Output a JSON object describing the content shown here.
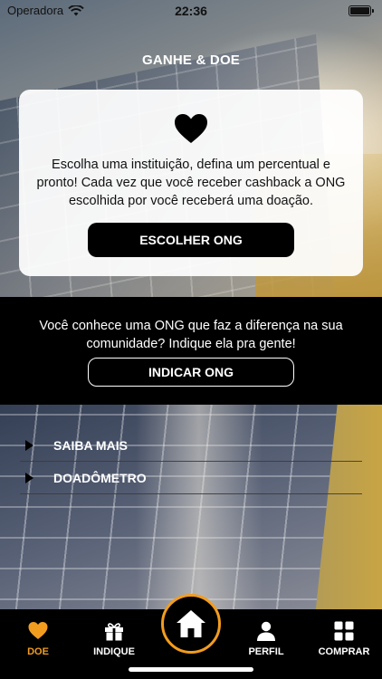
{
  "status_bar": {
    "carrier": "Operadora",
    "time": "22:36"
  },
  "header": {
    "title": "GANHE & DOE"
  },
  "card": {
    "icon": "heart-icon",
    "description": "Escolha uma instituição, defina um percentual e pronto! Cada vez que você receber cashback a ONG escolhida por você receberá uma doação.",
    "button_label": "ESCOLHER ONG"
  },
  "referral": {
    "message": "Você conhece uma ONG que faz a diferença na sua comunidade? Indique ela pra gente!",
    "button_label": "INDICAR ONG"
  },
  "accordion": {
    "items": [
      {
        "label": "SAIBA MAIS"
      },
      {
        "label": "DOADÔMETRO"
      }
    ]
  },
  "tabbar": {
    "accent_color": "#f29c1f",
    "tabs": [
      {
        "label": "DOE",
        "icon": "heart-icon",
        "active": true
      },
      {
        "label": "INDIQUE",
        "icon": "gift-icon",
        "active": false
      },
      {
        "label": "",
        "icon": "home-icon",
        "active": false
      },
      {
        "label": "PERFIL",
        "icon": "person-icon",
        "active": false
      },
      {
        "label": "COMPRAR",
        "icon": "grid-icon",
        "active": false
      }
    ]
  }
}
